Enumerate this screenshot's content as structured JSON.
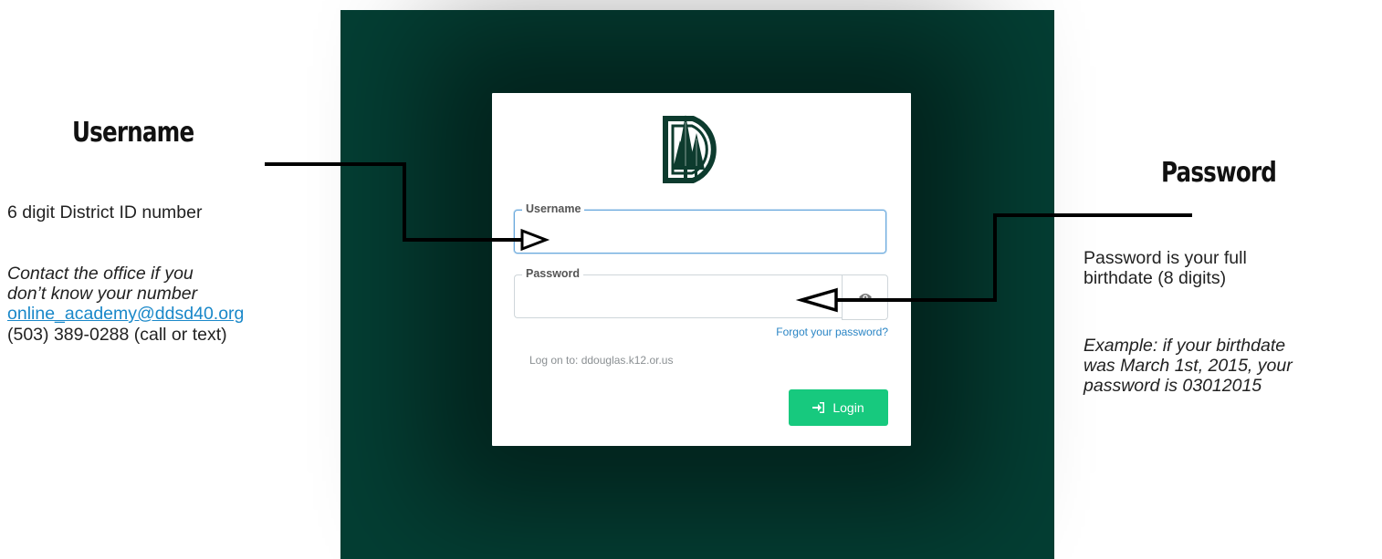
{
  "annotations": {
    "username": {
      "heading": "Username",
      "description": "6 digit District ID number",
      "contact_line1": "Contact the office if you",
      "contact_line2": "don’t know your number",
      "email": "online_academy@ddsd40.org",
      "phone": "(503) 389-0288 (call or text)"
    },
    "password": {
      "heading": "Password",
      "description_line1": "Password is your full",
      "description_line2": "birthdate (8 digits)",
      "example_line1": "Example: if your birthdate",
      "example_line2": "was March 1st, 2015, your",
      "example_line3": "password is  03012015"
    }
  },
  "login_form": {
    "logo_icon": "district-tree-logo-icon",
    "username_label": "Username",
    "username_value": "",
    "password_label": "Password",
    "password_value": "",
    "show_password_icon": "eye-icon",
    "forgot_link": "Forgot your password?",
    "logon_to": "Log on to: ddouglas.k12.or.us",
    "login_button": "Login",
    "login_icon": "sign-in-icon"
  },
  "colors": {
    "panel_background": "#043e33",
    "logo": "#0d3b2e",
    "login_button": "#17c97e",
    "link": "#2a85c5",
    "email_link": "#1a88c9"
  }
}
